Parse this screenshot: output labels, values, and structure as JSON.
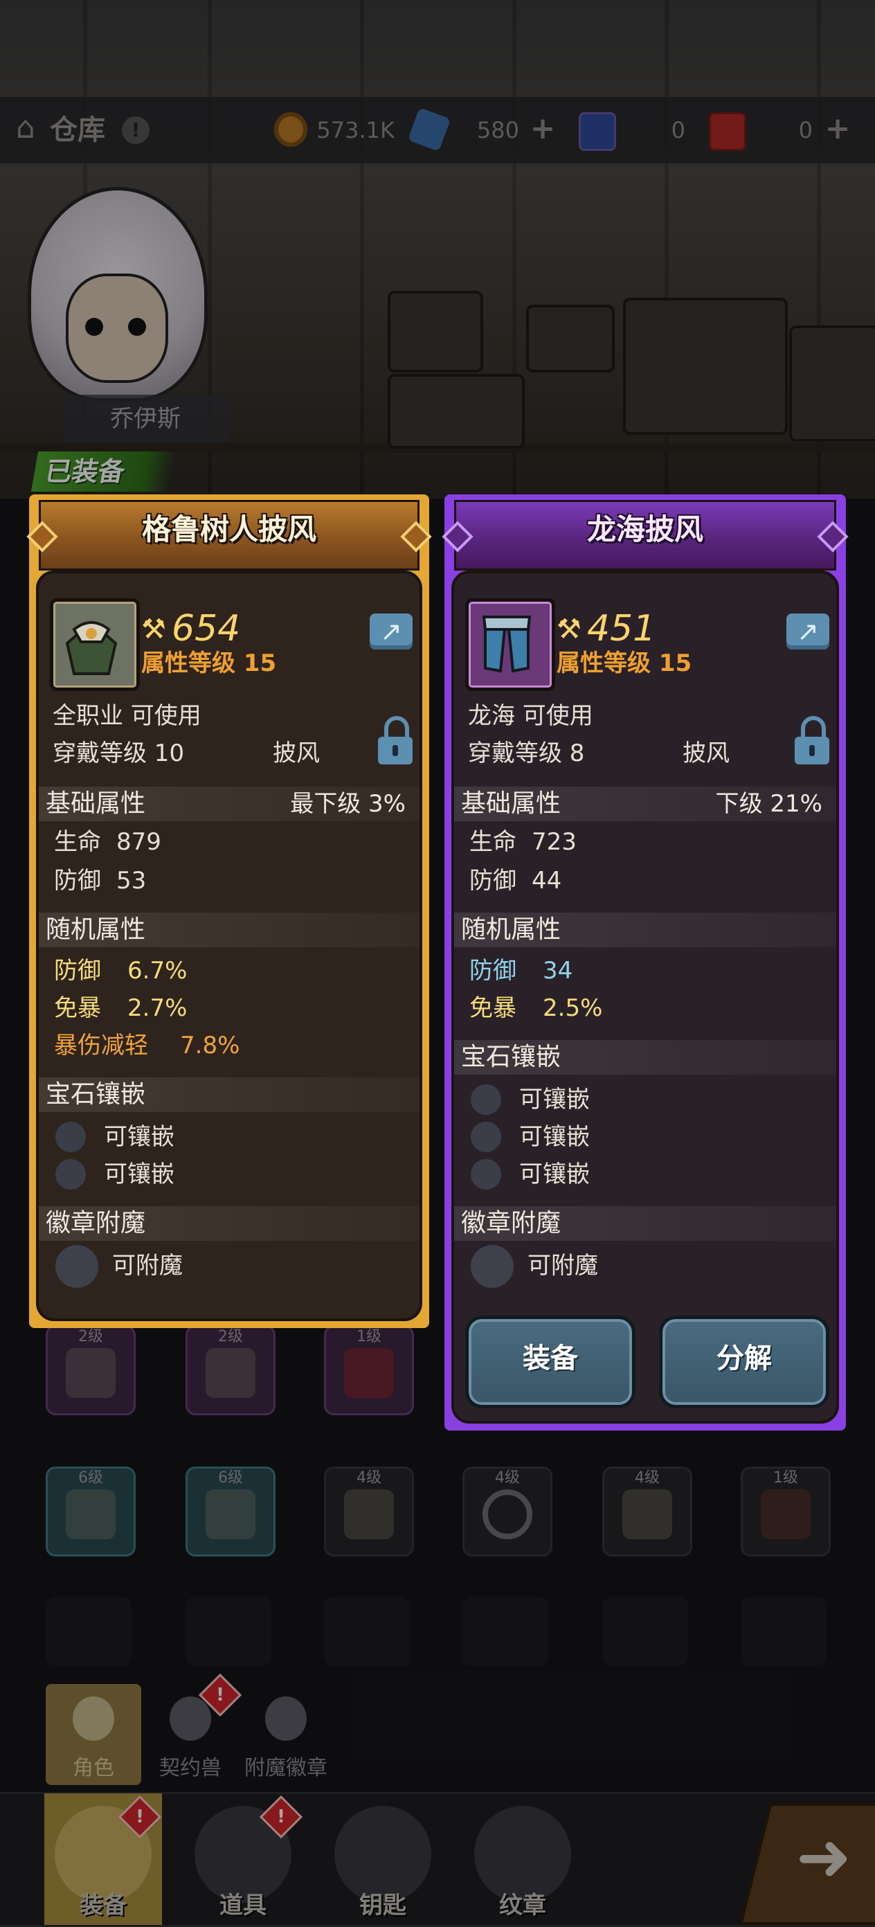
{
  "topbar": {
    "title": "仓库",
    "info_badge": "!",
    "resources": [
      {
        "icon": "gold-coin-icon",
        "value": "573.1K"
      },
      {
        "icon": "blue-crystal-icon",
        "value": "580"
      },
      {
        "icon": "blue-card-icon",
        "value": "0"
      },
      {
        "icon": "red-card-icon",
        "value": "0"
      }
    ]
  },
  "character": {
    "name": "乔伊斯"
  },
  "equipped_tag": "已装备",
  "equipped_item": {
    "name": "格鲁树人披风",
    "power": "654",
    "attr_level": "属性等级 15",
    "class_req": "全职业 可使用",
    "wear_level": "穿戴等级 10",
    "slot_type": "披风",
    "base_title": "基础属性",
    "base_grade": "最下级",
    "base_grade_pct": "3%",
    "base_stats": [
      {
        "name": "生命",
        "value": "879"
      },
      {
        "name": "防御",
        "value": "53"
      }
    ],
    "random_title": "随机属性",
    "random_stats": [
      {
        "name": "防御",
        "value": "6.7%"
      },
      {
        "name": "免暴",
        "value": "2.7%"
      },
      {
        "name": "暴伤减轻",
        "value": "7.8%"
      }
    ],
    "gem_title": "宝石镶嵌",
    "gem_slots": [
      "可镶嵌",
      "可镶嵌"
    ],
    "badge_title": "徽章附魔",
    "badge_slot": "可附魔"
  },
  "compare_item": {
    "name": "龙海披风",
    "power": "451",
    "attr_level": "属性等级 15",
    "class_req": "龙海 可使用",
    "wear_level": "穿戴等级 8",
    "slot_type": "披风",
    "base_title": "基础属性",
    "base_grade": "下级",
    "base_grade_pct": "21%",
    "base_stats": [
      {
        "name": "生命",
        "value": "723"
      },
      {
        "name": "防御",
        "value": "44"
      }
    ],
    "random_title": "随机属性",
    "random_stats": [
      {
        "name": "防御",
        "value": "34"
      },
      {
        "name": "免暴",
        "value": "2.5%"
      }
    ],
    "gem_title": "宝石镶嵌",
    "gem_slots": [
      "可镶嵌",
      "可镶嵌",
      "可镶嵌"
    ],
    "badge_title": "徽章附魔",
    "badge_slot": "可附魔",
    "equip_button": "装备",
    "dismantle_button": "分解"
  },
  "inventory": {
    "row1_levels": [
      "2级",
      "2级",
      "1级"
    ],
    "row2_levels": [
      "6级",
      "6级",
      "4级",
      "4级",
      "4级",
      "1级"
    ]
  },
  "subtabs": [
    {
      "label": "角色",
      "badge": ""
    },
    {
      "label": "契约兽",
      "badge": "!"
    },
    {
      "label": "附魔徽章",
      "badge": ""
    }
  ],
  "nav": [
    {
      "label": "装备",
      "badge": "!"
    },
    {
      "label": "道具",
      "badge": "!"
    },
    {
      "label": "钥匙",
      "badge": ""
    },
    {
      "label": "纹章",
      "badge": ""
    }
  ],
  "colors": {
    "equipped_frame": "#e4a733",
    "compare_frame": "#8a3fe3",
    "power": "#ffd46b",
    "attr_level": "#f0a030",
    "random_yellow": "#f5dc7a",
    "random_orange": "#f0a23c",
    "random_cyan": "#8fd4ec"
  }
}
